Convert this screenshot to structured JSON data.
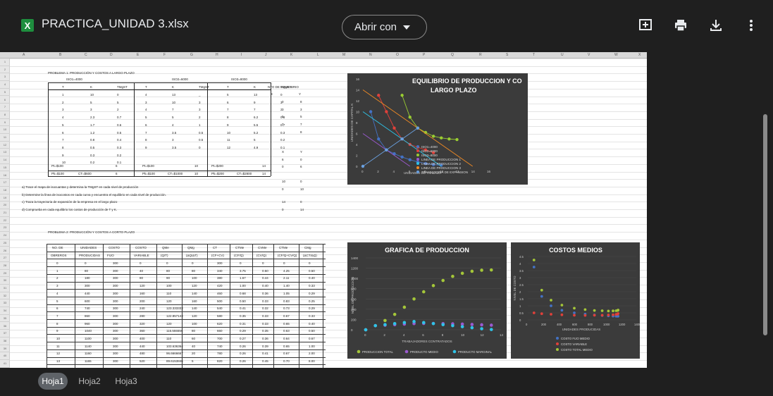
{
  "header": {
    "app_icon_letter": "X",
    "file_name": "PRACTICA_UNIDAD 3.xlsx",
    "open_with_label": "Abrir con",
    "icons": [
      "add-comment-icon",
      "print-icon",
      "download-icon",
      "more-vert-icon"
    ]
  },
  "sheet": {
    "columns": [
      "A",
      "B",
      "C",
      "D",
      "E",
      "F",
      "G",
      "H",
      "I",
      "J",
      "K",
      "L",
      "M",
      "N",
      "O",
      "P",
      "Q",
      "R",
      "S",
      "T",
      "U",
      "V",
      "W",
      "X"
    ],
    "rows": [
      "1",
      "2",
      "3",
      "4",
      "5",
      "6",
      "7",
      "8",
      "9",
      "10",
      "11",
      "12",
      "13",
      "14",
      "15",
      "16",
      "17",
      "18",
      "19",
      "20",
      "21",
      "22",
      "23",
      "24",
      "25",
      "26",
      "27",
      "28",
      "29",
      "30",
      "31",
      "32",
      "33",
      "34",
      "35",
      "36",
      "37",
      "38",
      "39",
      "40",
      "41"
    ],
    "problem1_title": "PROBLEMA 1: PRODUCCIÓN Y COSTOS A LARGO PLAZO",
    "iso_labels": [
      "ISO1=4000",
      "ISO2=6000",
      "ISO3=8000"
    ],
    "p1_headers": [
      "T",
      "K",
      "TMgST",
      "T",
      "K",
      "TMgST",
      "T",
      "K",
      "TMgST",
      "NTO DE EQUILIBRIO"
    ],
    "xy_headers": [
      "X",
      "Y"
    ],
    "p1_rows": [
      [
        "1",
        "10",
        "0",
        "4",
        "13",
        "_",
        "5",
        "13",
        "0"
      ],
      [
        "2",
        "5",
        "5",
        "3",
        "10",
        "3",
        "6",
        "9",
        "3"
      ],
      [
        "3",
        "3",
        "2",
        "4",
        "7",
        "3",
        "7",
        "7",
        "2"
      ],
      [
        "4",
        "2.3",
        "0.7",
        "5",
        "5",
        "2",
        "8",
        "6.2",
        "0.8"
      ],
      [
        "5",
        "1.7",
        "0.6",
        "6",
        "4",
        "1",
        "9",
        "5.5",
        "0.7"
      ],
      [
        "6",
        "1.2",
        "0.5",
        "7",
        "3.5",
        "0.5",
        "10",
        "5.2",
        "0.3"
      ],
      [
        "7",
        "0.8",
        "0.4",
        "8",
        "3",
        "0.5",
        "11",
        "5",
        "0.2"
      ],
      [
        "8",
        "0.5",
        "0.3",
        "9",
        "3.5",
        "0",
        "12",
        "4.9",
        "0.1"
      ],
      [
        "9",
        "0.3",
        "0.2",
        "",
        "",
        "",
        "",
        "",
        ""
      ],
      [
        "10",
        "0.2",
        "0.1",
        "",
        "",
        "",
        "",
        "",
        ""
      ]
    ],
    "p1_xy_pairs": [
      [
        "0",
        "8"
      ],
      [
        "3",
        "3"
      ],
      [
        "5",
        "5"
      ],
      [
        "7",
        "7"
      ],
      [
        "",
        "8"
      ]
    ],
    "p1_xy_second": [
      [
        "X",
        "Y"
      ],
      [
        "6",
        "0"
      ],
      [
        "0",
        "6"
      ]
    ],
    "p1_xy_third": [
      [
        "10",
        "0"
      ],
      [
        "0",
        "10"
      ]
    ],
    "p1_xy_fourth": [
      [
        "14",
        "0"
      ],
      [
        "0",
        "14"
      ]
    ],
    "p1_price_rows": [
      [
        "Pt=$100",
        "",
        "6",
        "Pt=$100",
        "",
        "10",
        "Pt=$200",
        "",
        "14"
      ],
      [
        "Pk=$100",
        "CT=$600",
        "6",
        "Pk=$100",
        "CT=$1000",
        "10",
        "Pk=$200",
        "CT=$2800",
        "14"
      ]
    ],
    "questions": [
      "a) Trace el mapa de isocuantas y determina la TMgST en cada nivel de producción",
      "b) Determine la línea de isocostos en cada curva y encuentra el equilibrio en cada nivel de producción.",
      "c) Traza la trayectoria de expansión de la empresa en el largo plazo",
      "d) Comprueba en cada equilibrio los costos de producción de T y K."
    ],
    "problem2_title": "PROBLEMA 2: PRODUCCIÓN Y COSTOS A CORTO PLAZO",
    "p2_headers_top": [
      "NO. DE",
      "UNIDADES",
      "COSTO",
      "COSTO",
      "QMe",
      "QMg",
      "CT",
      "CTMe",
      "CVMe",
      "CTMe",
      "CMg"
    ],
    "p2_headers_bottom": [
      "OBREROS",
      "PRODUCIDAS",
      "FIJO",
      "VARIABLE",
      "(Q/T)",
      "(ΔQ/ΔT)",
      "(CF+CV)",
      "(CF/Q)",
      "(CV/Q)",
      "(CF/Q+CV/Q)",
      "(ΔCT/ΔQ)"
    ],
    "p2_rows": [
      [
        "0",
        "0",
        "300",
        "0",
        "0",
        "0",
        "300",
        "0",
        "0",
        "0",
        "0"
      ],
      [
        "1",
        "80",
        "300",
        "40",
        "80",
        "80",
        "340",
        "3.75",
        "0.50",
        "4.25",
        "0.50"
      ],
      [
        "2",
        "180",
        "300",
        "80",
        "90",
        "100",
        "380",
        "1.67",
        "0.44",
        "2.11",
        "0.40"
      ],
      [
        "3",
        "300",
        "300",
        "120",
        "100",
        "120",
        "420",
        "1.00",
        "0.40",
        "1.40",
        "0.33"
      ],
      [
        "4",
        "440",
        "300",
        "160",
        "110",
        "140",
        "460",
        "0.68",
        "0.36",
        "1.05",
        "0.29"
      ],
      [
        "5",
        "600",
        "300",
        "200",
        "120",
        "160",
        "500",
        "0.50",
        "0.33",
        "0.83",
        "0.25"
      ],
      [
        "6",
        "740",
        "300",
        "240",
        "123.333333",
        "140",
        "540",
        "0.41",
        "0.32",
        "0.73",
        "0.29"
      ],
      [
        "7",
        "860",
        "300",
        "280",
        "122.857143",
        "120",
        "580",
        "0.35",
        "0.33",
        "0.67",
        "0.33"
      ],
      [
        "8",
        "960",
        "300",
        "320",
        "120",
        "100",
        "620",
        "0.31",
        "0.33",
        "0.65",
        "0.40"
      ],
      [
        "9",
        "1040",
        "300",
        "360",
        "115.555556",
        "80",
        "660",
        "0.29",
        "0.35",
        "0.63",
        "0.50"
      ],
      [
        "10",
        "1100",
        "300",
        "400",
        "110",
        "60",
        "700",
        "0.27",
        "0.36",
        "0.64",
        "0.67"
      ],
      [
        "11",
        "1140",
        "300",
        "440",
        "103.636364",
        "40",
        "740",
        "0.26",
        "0.39",
        "0.65",
        "1.00"
      ],
      [
        "12",
        "1160",
        "300",
        "480",
        "96.6666667",
        "20",
        "780",
        "0.26",
        "0.41",
        "0.67",
        "2.00"
      ],
      [
        "13",
        "1165",
        "300",
        "520",
        "89.6153846",
        "5",
        "820",
        "0.26",
        "0.45",
        "0.70",
        "8.00"
      ]
    ]
  },
  "chart1": {
    "title_line1": "EQUILIBRIO DE PRODUCCION Y CO",
    "title_line2": "LARGO PLAZO",
    "ylabel": "UNIDADES DE CAPITAL K",
    "xlabel": "UNIDADES DE TRABAJO",
    "y_ticks": [
      "16",
      "14",
      "12",
      "10",
      "8",
      "6",
      "4",
      "2",
      "0"
    ],
    "x_ticks": [
      "0",
      "2",
      "4",
      "6",
      "8",
      "10",
      "12",
      "14",
      "16"
    ],
    "legend": [
      "ISO1=4000",
      "ISO2=6000",
      "ISO3=8000",
      "LINEA DE PRODUCCION 1",
      "LINEA DE PRODUCCION 2",
      "LINEA DE PRODUCCION 3",
      "TRAYECTORIA DE EXPANSION"
    ],
    "colors": [
      "#4472c4",
      "#e0403a",
      "#9acd32",
      "#9b59d0",
      "#2ec4e8",
      "#f08a24",
      "#6aa0e0"
    ]
  },
  "chart2": {
    "title": "GRAFICA DE PRODUCCION",
    "ylabel": "NIVEL DE PRODUCCION",
    "xlabel": "TRABAJADORES CONTRATADOS",
    "y_ticks": [
      "1400",
      "1200",
      "1000",
      "800",
      "600",
      "400",
      "200",
      "0"
    ],
    "x_ticks": [
      "0",
      "2",
      "4",
      "6",
      "8",
      "10",
      "12",
      "14"
    ],
    "legend": [
      "PRODUCCION TOTAL",
      "PRODUCTO MEDIO",
      "PRODUCTO MARGINAL"
    ],
    "colors": [
      "#a4c639",
      "#9b59d0",
      "#2ec4e8"
    ]
  },
  "chart3": {
    "title": "COSTOS MEDIOS",
    "ylabel": "NIVEL DE COSTO",
    "xlabel": "UNIDADES PRODUCIDAS",
    "y_ticks": [
      "4.5",
      "4",
      "3.5",
      "3",
      "2.5",
      "2",
      "1.5",
      "1",
      "0.5",
      "0"
    ],
    "x_ticks": [
      "0",
      "200",
      "400",
      "600",
      "800",
      "1000",
      "1200",
      "1400"
    ],
    "legend": [
      "COSTO FIJO MEDIO",
      "COSTO VARIABLE",
      "COSTO TOTAL MEDIO"
    ],
    "colors": [
      "#4472c4",
      "#e0403a",
      "#a4c639"
    ]
  },
  "chart_data": [
    {
      "type": "line",
      "title": "EQUILIBRIO DE PRODUCCION Y CO LARGO PLAZO",
      "xlabel": "UNIDADES DE TRABAJO",
      "ylabel": "UNIDADES DE CAPITAL K",
      "xlim": [
        0,
        16
      ],
      "ylim": [
        0,
        16
      ],
      "series": [
        {
          "name": "ISO1=4000",
          "x": [
            1,
            2,
            3,
            4,
            5,
            6,
            7,
            8,
            9,
            10
          ],
          "y": [
            10,
            5,
            3,
            2.3,
            1.7,
            1.2,
            0.8,
            0.5,
            0.3,
            0.2
          ]
        },
        {
          "name": "ISO2=6000",
          "x": [
            2,
            3,
            4,
            5,
            6,
            7,
            8,
            9
          ],
          "y": [
            13,
            10,
            7,
            5,
            4,
            3.5,
            3,
            2.5
          ]
        },
        {
          "name": "ISO3=8000",
          "x": [
            5,
            6,
            7,
            8,
            9,
            10,
            11,
            12
          ],
          "y": [
            13,
            9,
            7,
            6.2,
            5.5,
            5.2,
            5,
            4.9
          ]
        },
        {
          "name": "LINEA DE PRODUCCION 1",
          "x": [
            0,
            6
          ],
          "y": [
            6,
            0
          ]
        },
        {
          "name": "LINEA DE PRODUCCION 2",
          "x": [
            0,
            10
          ],
          "y": [
            10,
            0
          ]
        },
        {
          "name": "LINEA DE PRODUCCION 3",
          "x": [
            0,
            14
          ],
          "y": [
            14,
            0
          ]
        },
        {
          "name": "TRAYECTORIA DE EXPANSION",
          "x": [
            0,
            3,
            5,
            7
          ],
          "y": [
            0,
            3,
            5,
            7
          ]
        }
      ]
    },
    {
      "type": "scatter",
      "title": "GRAFICA DE PRODUCCION",
      "xlabel": "TRABAJADORES CONTRATADOS",
      "ylabel": "NIVEL DE PRODUCCION",
      "xlim": [
        0,
        14
      ],
      "ylim": [
        0,
        1400
      ],
      "x": [
        0,
        1,
        2,
        3,
        4,
        5,
        6,
        7,
        8,
        9,
        10,
        11,
        12,
        13
      ],
      "series": [
        {
          "name": "PRODUCCION TOTAL",
          "values": [
            0,
            80,
            180,
            300,
            440,
            600,
            740,
            860,
            960,
            1040,
            1100,
            1140,
            1160,
            1165
          ]
        },
        {
          "name": "PRODUCTO MEDIO",
          "values": [
            0,
            80,
            90,
            100,
            110,
            120,
            123.3,
            122.9,
            120,
            115.6,
            110,
            103.6,
            96.7,
            89.6
          ]
        },
        {
          "name": "PRODUCTO MARGINAL",
          "values": [
            0,
            80,
            100,
            120,
            140,
            160,
            140,
            120,
            100,
            80,
            60,
            40,
            20,
            5
          ]
        }
      ]
    },
    {
      "type": "scatter",
      "title": "COSTOS MEDIOS",
      "xlabel": "UNIDADES PRODUCIDAS",
      "ylabel": "NIVEL DE COSTO",
      "xlim": [
        0,
        1400
      ],
      "ylim": [
        0,
        4.5
      ],
      "x": [
        80,
        180,
        300,
        440,
        600,
        740,
        860,
        960,
        1040,
        1100,
        1140,
        1160,
        1165
      ],
      "series": [
        {
          "name": "COSTO FIJO MEDIO",
          "values": [
            3.75,
            1.67,
            1.0,
            0.68,
            0.5,
            0.41,
            0.35,
            0.31,
            0.29,
            0.27,
            0.26,
            0.26,
            0.26
          ]
        },
        {
          "name": "COSTO VARIABLE",
          "values": [
            0.5,
            0.44,
            0.4,
            0.36,
            0.33,
            0.32,
            0.33,
            0.33,
            0.35,
            0.36,
            0.39,
            0.41,
            0.45
          ]
        },
        {
          "name": "COSTO TOTAL MEDIO",
          "values": [
            4.25,
            2.11,
            1.4,
            1.05,
            0.83,
            0.73,
            0.67,
            0.65,
            0.63,
            0.64,
            0.65,
            0.67,
            0.7
          ]
        }
      ]
    }
  ],
  "tabs": [
    "Hoja1",
    "Hoja2",
    "Hoja3"
  ],
  "active_tab": "Hoja1"
}
